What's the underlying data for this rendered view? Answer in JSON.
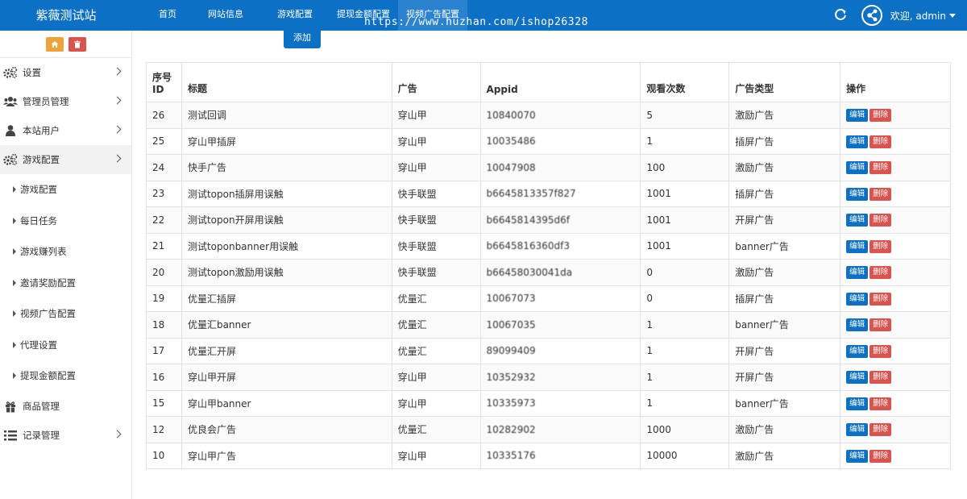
{
  "brand": "紫薇测试站",
  "nav": {
    "items": [
      "首页",
      "网站信息",
      "游戏配置",
      "提现金额配置",
      "视频广告配置"
    ],
    "active_index": 4
  },
  "watermark": "https://www.huzhan.com/ishop26328",
  "user": {
    "greeting": "欢迎, admin"
  },
  "sidebar": {
    "items": [
      {
        "label": "设置",
        "icon": "gears-icon",
        "has_chevron": true
      },
      {
        "label": "管理员管理",
        "icon": "users-icon",
        "has_chevron": true
      },
      {
        "label": "本站用户",
        "icon": "user-icon",
        "has_chevron": true
      },
      {
        "label": "游戏配置",
        "icon": "gears-icon",
        "has_chevron": true,
        "active": true
      }
    ],
    "sub_items": [
      "游戏配置",
      "每日任务",
      "游戏赚列表",
      "邀请奖励配置",
      "视频广告配置",
      "代理设置",
      "提现金额配置"
    ],
    "bottom_items": [
      {
        "label": "商品管理",
        "icon": "gift-icon",
        "has_chevron": false
      },
      {
        "label": "记录管理",
        "icon": "list-icon",
        "has_chevron": true
      }
    ]
  },
  "toolbar": {
    "add_label": "添加"
  },
  "table": {
    "headers": {
      "id_line1": "序号",
      "id_line2": "ID",
      "title": "标题",
      "ad": "广告",
      "appid": "Appid",
      "views": "观看次数",
      "type": "广告类型",
      "ops": "操作"
    },
    "edit_label": "编辑",
    "delete_label": "删除",
    "rows": [
      {
        "id": "26",
        "title": "测试回调",
        "ad": "穿山甲",
        "appid": "10840070",
        "views": "5",
        "type": "激励广告"
      },
      {
        "id": "25",
        "title": "穿山甲插屏",
        "ad": "穿山甲",
        "appid": "10035486",
        "views": "1",
        "type": "插屏广告"
      },
      {
        "id": "24",
        "title": "快手广告",
        "ad": "穿山甲",
        "appid": "10047908",
        "views": "100",
        "type": "激励广告"
      },
      {
        "id": "23",
        "title": "测试topon插屏用误触",
        "ad": "快手联盟",
        "appid": "b6645813357f827",
        "views": "1001",
        "type": "插屏广告"
      },
      {
        "id": "22",
        "title": "测试topon开屏用误触",
        "ad": "快手联盟",
        "appid": "b6645814395d6f",
        "views": "1001",
        "type": "开屏广告"
      },
      {
        "id": "21",
        "title": "测试toponbanner用误触",
        "ad": "快手联盟",
        "appid": "b6645816360df3",
        "views": "1001",
        "type": "banner广告"
      },
      {
        "id": "20",
        "title": "测试topon激励用误触",
        "ad": "快手联盟",
        "appid": "b66458030041da",
        "views": "0",
        "type": "激励广告"
      },
      {
        "id": "19",
        "title": "优量汇插屏",
        "ad": "优量汇",
        "appid": "10067073",
        "views": "0",
        "type": "插屏广告"
      },
      {
        "id": "18",
        "title": "优量汇banner",
        "ad": "优量汇",
        "appid": "10067035",
        "views": "1",
        "type": "banner广告"
      },
      {
        "id": "17",
        "title": "优量汇开屏",
        "ad": "优量汇",
        "appid": "89099409",
        "views": "1",
        "type": "开屏广告"
      },
      {
        "id": "16",
        "title": "穿山甲开屏",
        "ad": "穿山甲",
        "appid": "10352932",
        "views": "1",
        "type": "开屏广告"
      },
      {
        "id": "15",
        "title": "穿山甲banner",
        "ad": "穿山甲",
        "appid": "10335973",
        "views": "1",
        "type": "banner广告"
      },
      {
        "id": "12",
        "title": "优良会广告",
        "ad": "优量汇",
        "appid": "10282902",
        "views": "1000",
        "type": "激励广告"
      },
      {
        "id": "10",
        "title": "穿山甲广告",
        "ad": "穿山甲",
        "appid": "10335176",
        "views": "10000",
        "type": "激励广告"
      }
    ]
  },
  "colors": {
    "primary": "#0c70c4",
    "danger": "#d9534f",
    "warning": "#f0a23a"
  }
}
